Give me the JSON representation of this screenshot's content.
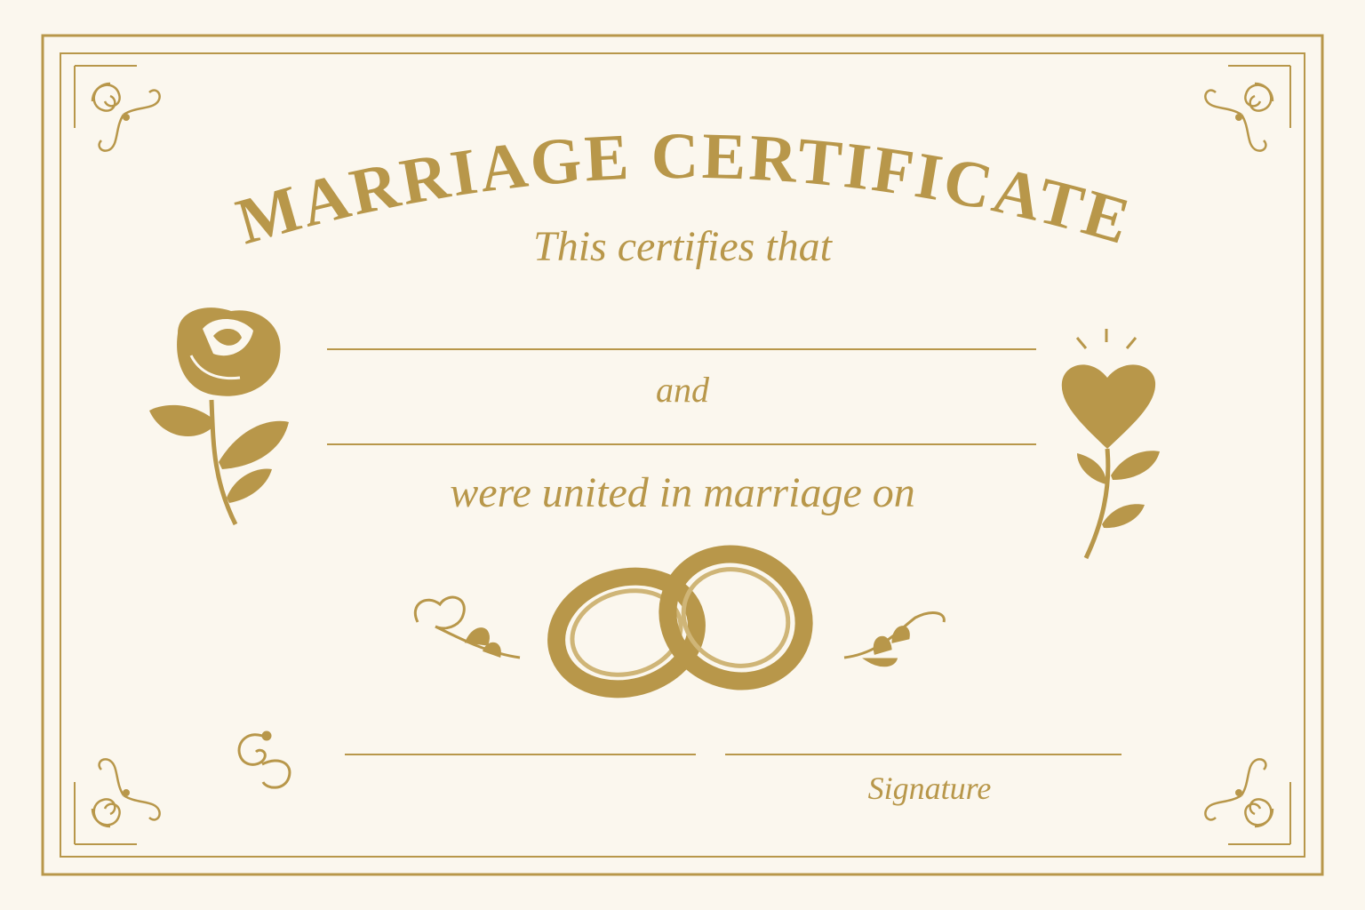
{
  "certificate": {
    "title": "MARRIAGE CERTIFICATE",
    "intro": "This certifies that",
    "conjunction": "and",
    "union_text": "were united in marriage on",
    "signature_label": "Signature"
  },
  "colors": {
    "gold": "#b8974a",
    "paper": "#fbf7ee"
  },
  "icons": [
    "rose-icon",
    "heart-flower-icon",
    "wedding-rings-icon",
    "small-flower-icon",
    "leaf-sprig-icon",
    "swirl-ornament-icon",
    "corner-flourish-icon"
  ]
}
